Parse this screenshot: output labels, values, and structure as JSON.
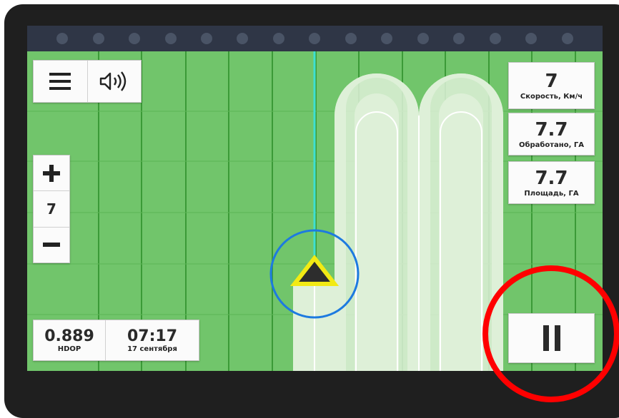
{
  "leds": 15,
  "menu": {
    "icon": "hamburger-menu-icon",
    "sound_icon": "speaker-volume-icon"
  },
  "zoom": {
    "plus_icon": "plus-icon",
    "level": "7",
    "minus_icon": "minus-icon"
  },
  "stats": [
    {
      "value": "7",
      "label": "Скорость, Км/ч"
    },
    {
      "value": "7.7",
      "label": "Обработано, ГА"
    },
    {
      "value": "7.7",
      "label": "Площадь, ГА"
    }
  ],
  "gps": {
    "hdop_value": "0.889",
    "hdop_label": "HDOP"
  },
  "clock": {
    "time": "07:17",
    "date": "17 сентября"
  },
  "pause": {
    "icon": "pause-icon"
  },
  "colors": {
    "field": "#71c56b",
    "grid_line": "#3b9a37",
    "coverage": "#def0d8",
    "guide_line": "#3fe0d2",
    "vehicle": "#2d2d2d",
    "vehicle_outline": "#f2ea14",
    "position_ring": "#1d7ae0",
    "highlight_ring": "#ff0000"
  }
}
